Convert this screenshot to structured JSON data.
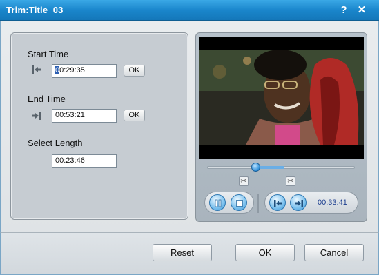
{
  "window": {
    "title": "Trim:Title_03",
    "help_label": "?",
    "close_label": "✕"
  },
  "trim": {
    "start_label": "Start Time",
    "start_value": "00:29:35",
    "start_caret": "0",
    "start_rest": "0:29:35",
    "start_ok": "OK",
    "end_label": "End Time",
    "end_value": "00:53:21",
    "end_ok": "OK",
    "length_label": "Select Length",
    "length_value": "00:23:46",
    "icons": {
      "start": "set-start-icon",
      "end": "set-end-icon"
    }
  },
  "player": {
    "current_time": "00:33:41",
    "progress_fraction": 0.33,
    "icons": {
      "pause": "pause-icon",
      "stop": "stop-icon",
      "mark_start": "mark-start-icon",
      "mark_end": "mark-end-icon",
      "cut_start": "scissors-icon",
      "cut_end": "scissors-icon"
    }
  },
  "footer": {
    "reset_label": "Reset",
    "ok_label": "OK",
    "cancel_label": "Cancel"
  },
  "colors": {
    "titlebar": "#1a86cc",
    "accent": "#3c93d1",
    "time_text": "#1c3e8f"
  }
}
